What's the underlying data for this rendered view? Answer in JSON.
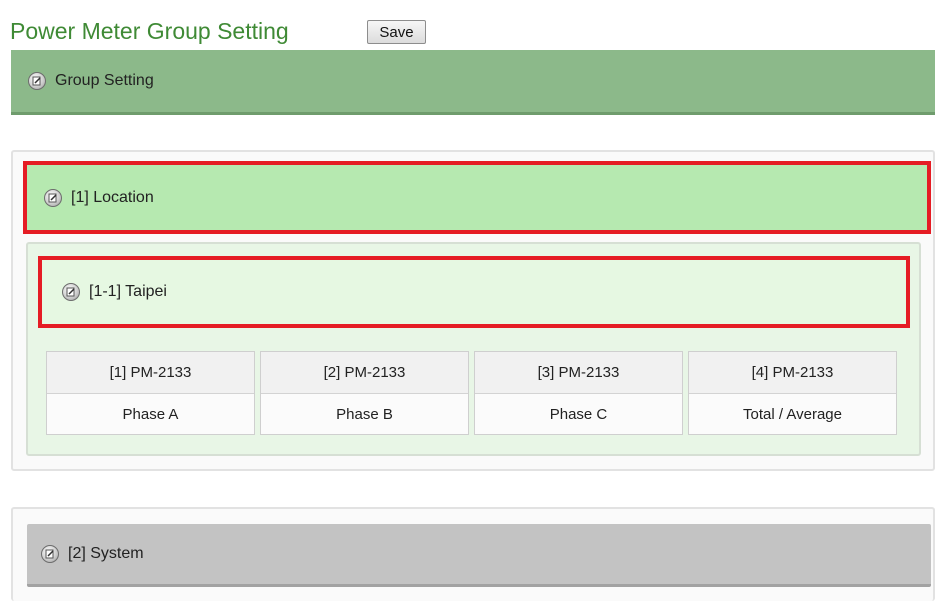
{
  "header": {
    "title": "Power Meter Group Setting",
    "save_label": "Save"
  },
  "group_setting": {
    "label": "Group Setting"
  },
  "location": {
    "label": "[1] Location",
    "sub_group": {
      "label": "[1-1] Taipei",
      "meters": [
        {
          "name": "[1] PM-2133",
          "phase": "Phase A"
        },
        {
          "name": "[2] PM-2133",
          "phase": "Phase B"
        },
        {
          "name": "[3] PM-2133",
          "phase": "Phase C"
        },
        {
          "name": "[4] PM-2133",
          "phase": "Total / Average"
        }
      ]
    }
  },
  "system": {
    "label": "[2] System"
  },
  "icons": {
    "edit": "edit-icon"
  },
  "colors": {
    "title": "#3f8a35",
    "group_bar": "#8cb98a",
    "location_bar": "#b6e9b0",
    "taipei_bar": "#e6f8e2",
    "system_bar": "#c3c3c3",
    "highlight": "#e51c24"
  }
}
